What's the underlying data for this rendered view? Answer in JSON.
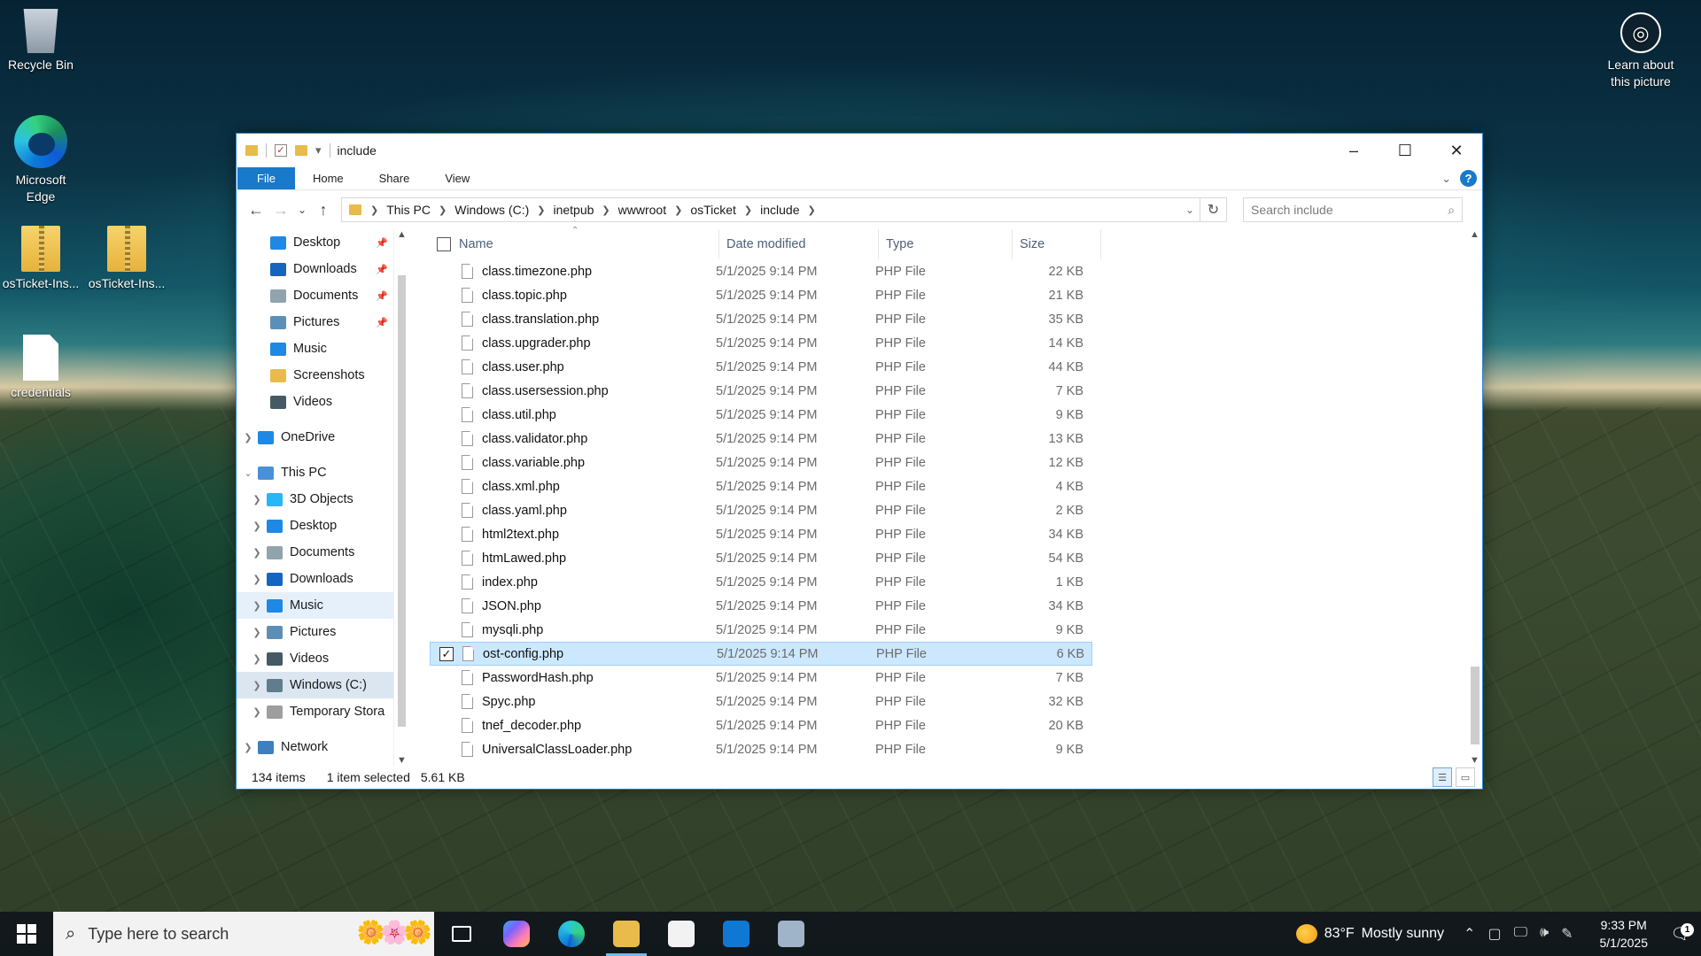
{
  "desktop": {
    "icons": [
      {
        "label": "Recycle Bin",
        "icon": "recycle-bin-icon"
      },
      {
        "label": "Microsoft Edge",
        "icon": "edge-icon"
      },
      {
        "label": "osTicket-Ins...",
        "icon": "zip-folder-icon"
      },
      {
        "label": "osTicket-Ins...",
        "icon": "zip-folder-icon"
      },
      {
        "label": "credentials",
        "icon": "text-document-icon"
      }
    ],
    "learn": {
      "line1": "Learn about",
      "line2": "this picture",
      "icon": "camera-icon"
    }
  },
  "window": {
    "title": "include",
    "controls": {
      "minimize": "–",
      "maximize": "☐",
      "close": "✕"
    }
  },
  "ribbon": {
    "tabs": [
      "File",
      "Home",
      "Share",
      "View"
    ],
    "active": "File"
  },
  "address": {
    "crumbs": [
      "This PC",
      "Windows (C:)",
      "inetpub",
      "wwwroot",
      "osTicket",
      "include"
    ],
    "search_placeholder": "Search include"
  },
  "nav_pane": {
    "quick_access": [
      {
        "label": "Desktop",
        "icon": "desktop-icon",
        "pinned": true,
        "color": "#1e88e5"
      },
      {
        "label": "Downloads",
        "icon": "download-icon",
        "pinned": true,
        "color": "#1565c0"
      },
      {
        "label": "Documents",
        "icon": "documents-icon",
        "pinned": true,
        "color": "#90a4ae"
      },
      {
        "label": "Pictures",
        "icon": "pictures-icon",
        "pinned": true,
        "color": "#5c8fb8"
      },
      {
        "label": "Music",
        "icon": "music-icon",
        "pinned": false,
        "color": "#1e88e5"
      },
      {
        "label": "Screenshots",
        "icon": "folder-icon",
        "pinned": false,
        "color": "#e8bb4a"
      },
      {
        "label": "Videos",
        "icon": "videos-icon",
        "pinned": false,
        "color": "#455a64"
      }
    ],
    "onedrive": "OneDrive",
    "this_pc": "This PC",
    "this_pc_items": [
      {
        "label": "3D Objects",
        "icon": "3d-objects-icon",
        "color": "#29b6f6"
      },
      {
        "label": "Desktop",
        "icon": "desktop-icon",
        "color": "#1e88e5"
      },
      {
        "label": "Documents",
        "icon": "documents-icon",
        "color": "#90a4ae"
      },
      {
        "label": "Downloads",
        "icon": "download-icon",
        "color": "#1565c0"
      },
      {
        "label": "Music",
        "icon": "music-icon",
        "color": "#1e88e5"
      },
      {
        "label": "Pictures",
        "icon": "pictures-icon",
        "color": "#5c8fb8"
      },
      {
        "label": "Videos",
        "icon": "videos-icon",
        "color": "#455a64"
      },
      {
        "label": "Windows (C:)",
        "icon": "drive-icon",
        "color": "#607d8b"
      },
      {
        "label": "Temporary Stora",
        "icon": "drive-icon",
        "color": "#9e9e9e"
      }
    ],
    "network": "Network",
    "hovered": "Music",
    "selected": "Windows (C:)"
  },
  "columns": {
    "name": "Name",
    "date": "Date modified",
    "type": "Type",
    "size": "Size"
  },
  "files": [
    {
      "name": "class.timezone.php",
      "date": "5/1/2025 9:14 PM",
      "type": "PHP File",
      "size": "22 KB"
    },
    {
      "name": "class.topic.php",
      "date": "5/1/2025 9:14 PM",
      "type": "PHP File",
      "size": "21 KB"
    },
    {
      "name": "class.translation.php",
      "date": "5/1/2025 9:14 PM",
      "type": "PHP File",
      "size": "35 KB"
    },
    {
      "name": "class.upgrader.php",
      "date": "5/1/2025 9:14 PM",
      "type": "PHP File",
      "size": "14 KB"
    },
    {
      "name": "class.user.php",
      "date": "5/1/2025 9:14 PM",
      "type": "PHP File",
      "size": "44 KB"
    },
    {
      "name": "class.usersession.php",
      "date": "5/1/2025 9:14 PM",
      "type": "PHP File",
      "size": "7 KB"
    },
    {
      "name": "class.util.php",
      "date": "5/1/2025 9:14 PM",
      "type": "PHP File",
      "size": "9 KB"
    },
    {
      "name": "class.validator.php",
      "date": "5/1/2025 9:14 PM",
      "type": "PHP File",
      "size": "13 KB"
    },
    {
      "name": "class.variable.php",
      "date": "5/1/2025 9:14 PM",
      "type": "PHP File",
      "size": "12 KB"
    },
    {
      "name": "class.xml.php",
      "date": "5/1/2025 9:14 PM",
      "type": "PHP File",
      "size": "4 KB"
    },
    {
      "name": "class.yaml.php",
      "date": "5/1/2025 9:14 PM",
      "type": "PHP File",
      "size": "2 KB"
    },
    {
      "name": "html2text.php",
      "date": "5/1/2025 9:14 PM",
      "type": "PHP File",
      "size": "34 KB"
    },
    {
      "name": "htmLawed.php",
      "date": "5/1/2025 9:14 PM",
      "type": "PHP File",
      "size": "54 KB"
    },
    {
      "name": "index.php",
      "date": "5/1/2025 9:14 PM",
      "type": "PHP File",
      "size": "1 KB"
    },
    {
      "name": "JSON.php",
      "date": "5/1/2025 9:14 PM",
      "type": "PHP File",
      "size": "34 KB"
    },
    {
      "name": "mysqli.php",
      "date": "5/1/2025 9:14 PM",
      "type": "PHP File",
      "size": "9 KB"
    },
    {
      "name": "ost-config.php",
      "date": "5/1/2025 9:14 PM",
      "type": "PHP File",
      "size": "6 KB",
      "selected": true
    },
    {
      "name": "PasswordHash.php",
      "date": "5/1/2025 9:14 PM",
      "type": "PHP File",
      "size": "7 KB"
    },
    {
      "name": "Spyc.php",
      "date": "5/1/2025 9:14 PM",
      "type": "PHP File",
      "size": "32 KB"
    },
    {
      "name": "tnef_decoder.php",
      "date": "5/1/2025 9:14 PM",
      "type": "PHP File",
      "size": "20 KB"
    },
    {
      "name": "UniversalClassLoader.php",
      "date": "5/1/2025 9:14 PM",
      "type": "PHP File",
      "size": "9 KB"
    }
  ],
  "status": {
    "items": "134 items",
    "selected": "1 item selected",
    "size": "5.61 KB"
  },
  "taskbar": {
    "search_placeholder": "Type here to search",
    "apps": [
      {
        "name": "task-view",
        "color": "#ffffff"
      },
      {
        "name": "copilot",
        "color": "#7b61ff"
      },
      {
        "name": "edge",
        "color": "#1e90d6"
      },
      {
        "name": "file-explorer",
        "color": "#e8bb4a",
        "active": true
      },
      {
        "name": "microsoft-store",
        "color": "#f2f2f2"
      },
      {
        "name": "outlook",
        "color": "#0f78d4"
      },
      {
        "name": "server-manager",
        "color": "#9fb4c8"
      }
    ],
    "weather": {
      "temp": "83°F",
      "desc": "Mostly sunny"
    },
    "time": "9:33 PM",
    "date": "5/1/2025",
    "notifications": "1"
  }
}
